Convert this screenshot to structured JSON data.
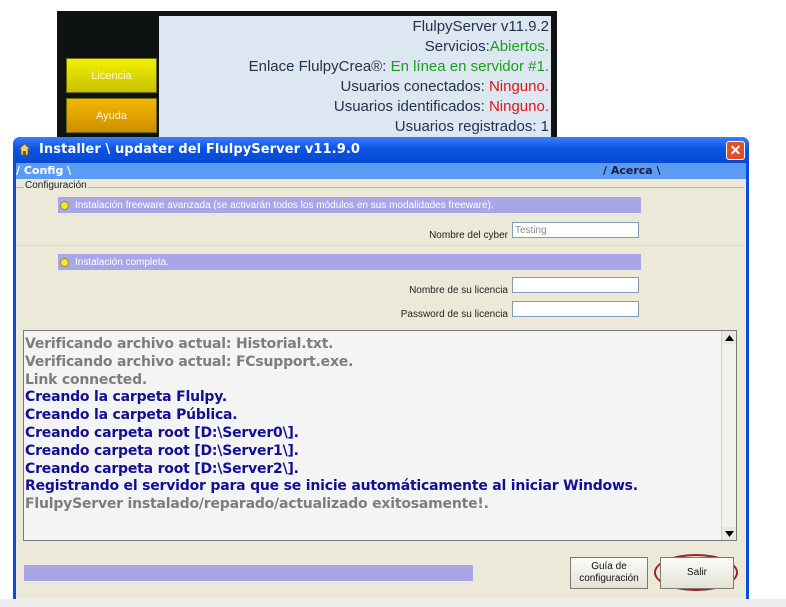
{
  "background_app": {
    "buttons": [
      "Licencia",
      "Ayuda"
    ],
    "status_lines": [
      {
        "parts": [
          {
            "text": "FlulpyServer v11.9.2",
            "color": "normal"
          }
        ]
      },
      {
        "parts": [
          {
            "text": "Servicios:",
            "color": "normal"
          },
          {
            "text": "Abiertos.",
            "color": "green"
          }
        ]
      },
      {
        "parts": [
          {
            "text": "Enlace FlulpyCrea®: ",
            "color": "normal"
          },
          {
            "text": "En línea en servidor #1.",
            "color": "green"
          }
        ]
      },
      {
        "parts": [
          {
            "text": "Usuarios conectados: ",
            "color": "normal"
          },
          {
            "text": "Ninguno.",
            "color": "red"
          }
        ]
      },
      {
        "parts": [
          {
            "text": "Usuarios identificados: ",
            "color": "normal"
          },
          {
            "text": "Ninguno.",
            "color": "red"
          }
        ]
      },
      {
        "parts": [
          {
            "text": "Usuarios registrados: 1",
            "color": "normal"
          }
        ]
      }
    ]
  },
  "window": {
    "title": "Installer \\ updater del FlulpyServer v11.9.0",
    "close_glyph": "✕",
    "tabs": {
      "config": "/  Config  \\",
      "acerca": "/  Acerca  \\"
    },
    "group_label": "Configuración",
    "option1_label": "Instalación freeware avanzada (se activarán todos los módulos en sus modalidades freeware).",
    "cyber_label": "Nombre del cyber",
    "cyber_value": "Testing",
    "option2_label": "Instalación completa.",
    "licencia_label": "Nombre de su licencia",
    "licencia_value": "",
    "password_label": "Password de su licencia",
    "password_value": "",
    "log": [
      {
        "text": "Verificando archivo actual: Historial.txt.",
        "style": "gray"
      },
      {
        "text": "Verificando archivo actual: FCsupport.exe.",
        "style": "gray"
      },
      {
        "text": "Link connected.",
        "style": "gray"
      },
      {
        "text": "Creando la carpeta Flulpy.",
        "style": "blue"
      },
      {
        "text": "Creando la carpeta Pública.",
        "style": "blue"
      },
      {
        "text": "Creando carpeta root [D:\\Server0\\].",
        "style": "blue"
      },
      {
        "text": "Creando carpeta root [D:\\Server1\\].",
        "style": "blue"
      },
      {
        "text": "Creando carpeta root [D:\\Server2\\].",
        "style": "blue"
      },
      {
        "text": "Registrando el servidor para que se inicie automáticamente al iniciar Windows.",
        "style": "blue"
      },
      {
        "text": "FlulpyServer instalado/reparado/actualizado exitosamente!.",
        "style": "gray"
      }
    ],
    "guia_line1": "Guía de",
    "guia_line2": "configuración",
    "salir_label": "Salir"
  },
  "colors": {
    "titlebar": "#0a54e6",
    "option_bar": "#a7a6e8",
    "log_blue": "#120f95",
    "log_gray": "#7d7d7d",
    "highlight_ring": "#a02024"
  }
}
